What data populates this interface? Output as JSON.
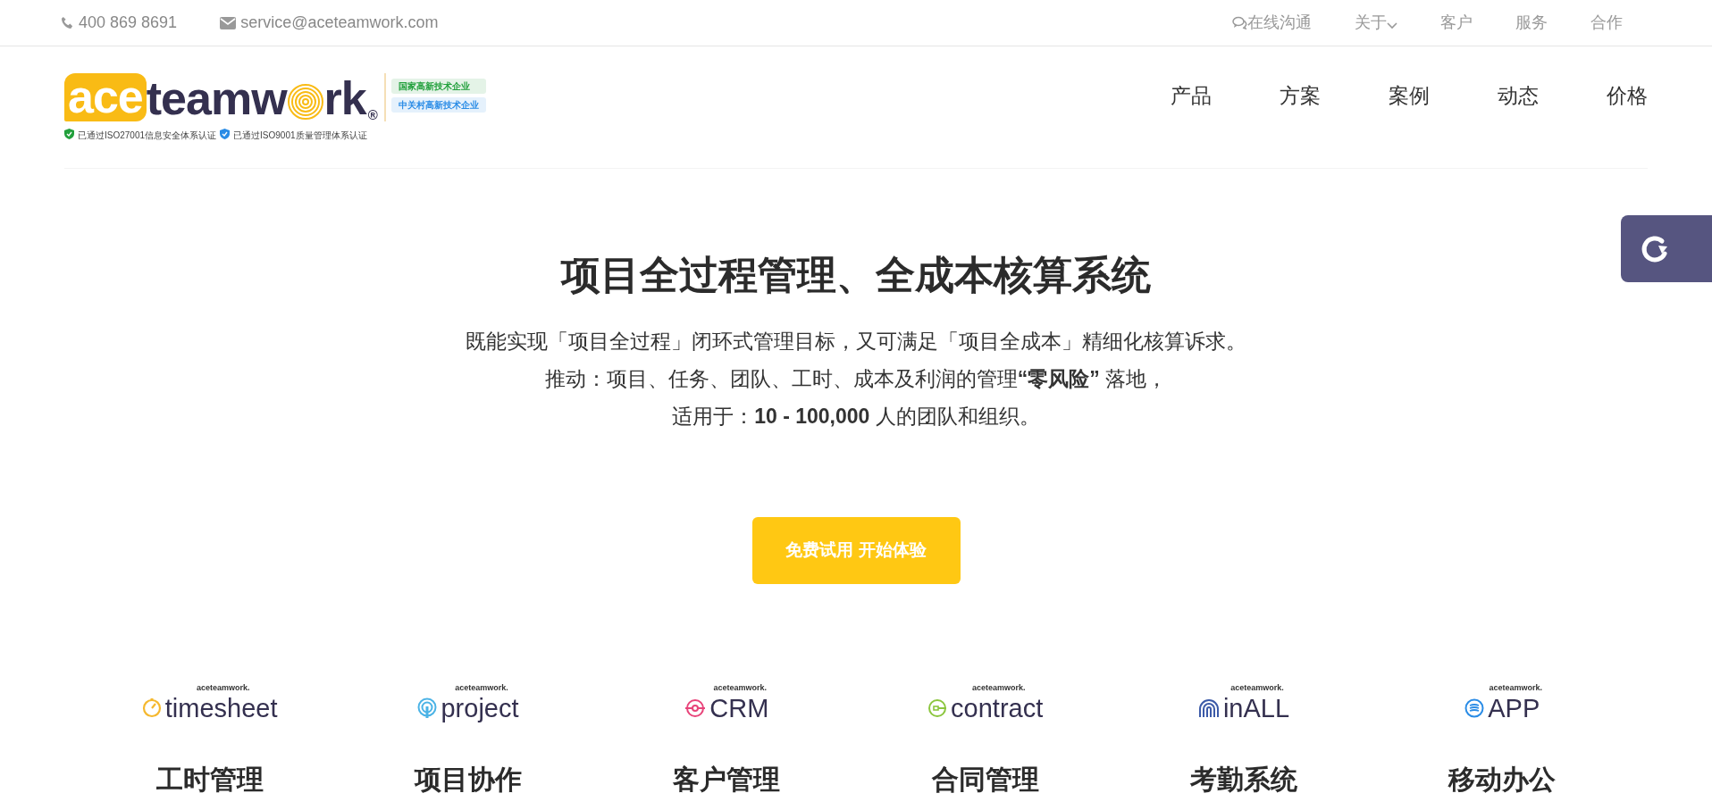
{
  "top_bar": {
    "phone": "400 869 8691",
    "email": "service@aceteamwork.com",
    "links": [
      {
        "label": "在线沟通",
        "kind": "chat"
      },
      {
        "label": "关于",
        "kind": "dropdown"
      },
      {
        "label": "客户",
        "kind": "plain"
      },
      {
        "label": "服务",
        "kind": "plain"
      },
      {
        "label": "合作",
        "kind": "plain"
      }
    ]
  },
  "header": {
    "logo": {
      "highlight": "ace",
      "word_start": "teamw",
      "word_end": "rk",
      "registered": "®"
    },
    "badges": [
      {
        "label": "国家高新技术企业",
        "color": "#22a03c"
      },
      {
        "label": "中关村高新技术企业",
        "color": "#2a8ce6"
      }
    ],
    "certifications": [
      {
        "label": "已通过ISO27001信息安全体系认证",
        "color": "#22a03c"
      },
      {
        "label": "已通过ISO9001质量管理体系认证",
        "color": "#2a8ce6"
      }
    ],
    "nav": [
      "产品",
      "方案",
      "案例",
      "动态",
      "价格"
    ]
  },
  "hero": {
    "title": "项目全过程管理、全成本核算系统",
    "lines": [
      "既能实现「项目全过程」闭环式管理目标，又可满足「项目全成本」精细化核算诉求。",
      "推动：项目、任务、团队、工时、成本及利润的管理**“零风险”** 落地，",
      "适用于：**10 - 100,000** 人的团队和组织。"
    ],
    "button": "免费试用 开始体验"
  },
  "products": [
    {
      "brand": "aceteamwork.",
      "name": "timesheet",
      "kind": "gauge",
      "color": "#f5b82e",
      "title": "工时管理"
    },
    {
      "brand": "aceteamwork.",
      "name": "project",
      "kind": "signal",
      "color": "#4bb3e6",
      "title": "项目协作"
    },
    {
      "brand": "aceteamwork.",
      "name": "CRM",
      "kind": "target",
      "color": "#e8447a",
      "title": "客户管理"
    },
    {
      "brand": "aceteamwork.",
      "name": "contract",
      "kind": "key",
      "color": "#8cc63f",
      "title": "合同管理"
    },
    {
      "brand": "aceteamwork.",
      "name": "inALL",
      "kind": "fingerprint",
      "color": "#3c5aa8",
      "title": "考勤系统"
    },
    {
      "brand": "aceteamwork.",
      "name": "APP",
      "kind": "waves",
      "color": "#2a8ce6",
      "title": "移动办公"
    }
  ]
}
